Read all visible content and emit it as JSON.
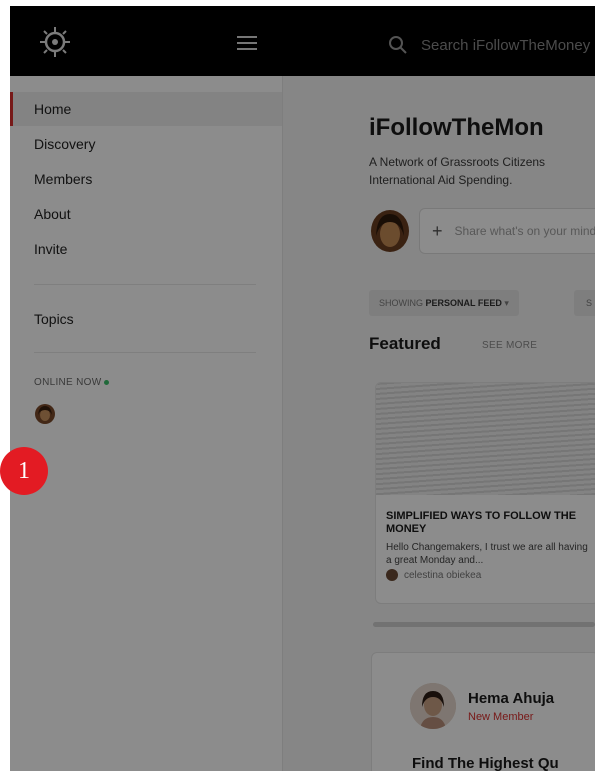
{
  "header": {
    "search_placeholder": "Search iFollowTheMoney"
  },
  "sidebar": {
    "items": [
      {
        "label": "Home"
      },
      {
        "label": "Discovery"
      },
      {
        "label": "Members"
      },
      {
        "label": "About"
      },
      {
        "label": "Invite"
      }
    ],
    "topics_label": "Topics",
    "online_label": "ONLINE NOW"
  },
  "badge": {
    "number": "1"
  },
  "main": {
    "title": "iFollowTheMon",
    "description": "A Network of Grassroots Citizens International Aid Spending.",
    "composer_placeholder": "Share what's on your mind",
    "feed_filter_prefix": "SHOWING",
    "feed_filter_value": "PERSONAL FEED",
    "feed_filter_caret": "▾",
    "feed_filter2": "S",
    "featured_title": "Featured",
    "see_more": "SEE MORE",
    "featured_card": {
      "title": "SIMPLIFIED WAYS TO FOLLOW THE MONEY",
      "excerpt": "Hello Changemakers, I trust we are all having a great Monday and...",
      "author": "celestina obiekea"
    },
    "post": {
      "name": "Hema Ahuja",
      "role": "New Member",
      "title": "Find The Highest Qu"
    }
  },
  "colors": {
    "accent": "#d9302f",
    "online": "#3bbf6b",
    "badge": "#e31b23"
  }
}
